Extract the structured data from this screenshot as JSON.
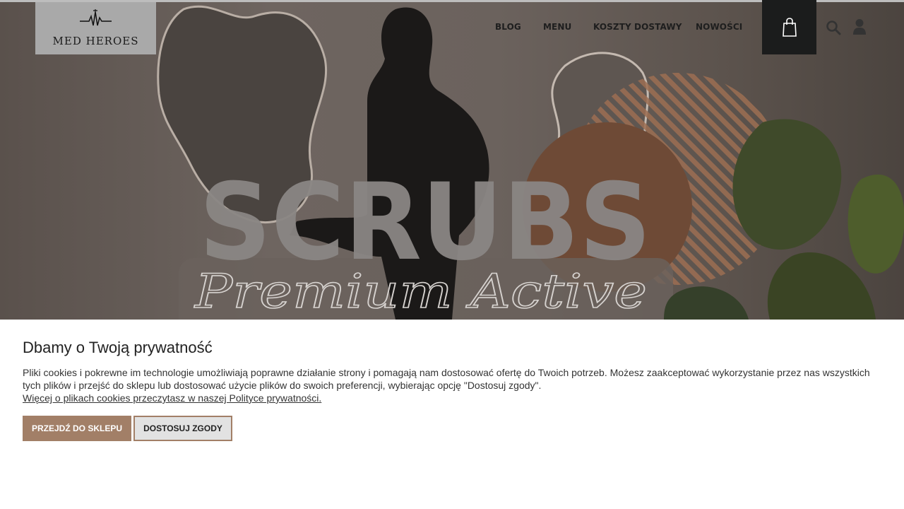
{
  "header": {
    "logo_text": "MED HEROES",
    "nav": [
      {
        "label": "BLOG"
      },
      {
        "label": "MENU"
      },
      {
        "label": "KOSZTY DOSTAWY"
      },
      {
        "label": "NOWOŚCI"
      }
    ],
    "icons": [
      "shopping-bag-icon",
      "search-icon",
      "user-icon"
    ]
  },
  "hero": {
    "headline": "SCRUBS",
    "script": "Premium Active"
  },
  "cookie": {
    "title": "Dbamy o Twoją prywatność",
    "text": "Pliki cookies i pokrewne im technologie umożliwiają poprawne działanie strony i pomagają nam dostosować ofertę do Twoich potrzeb. Możesz zaakceptować wykorzystanie przez nas wszystkich tych plików i przejść do sklepu lub dostosować użycie plików do swoich preferencji, wybierając opcję \"Dostosuj zgody\".",
    "link": "Więcej o plikach cookies przeczytasz w naszej Polityce prywatności.",
    "accept_button": "PRZEJDŹ DO SKLEPU",
    "customize_button": "DOSTOSUJ ZGODY"
  },
  "colors": {
    "brand_accent": "#a27f67",
    "cart_bg": "#1b1c1c",
    "logo_bg": "#a9a9a9"
  }
}
